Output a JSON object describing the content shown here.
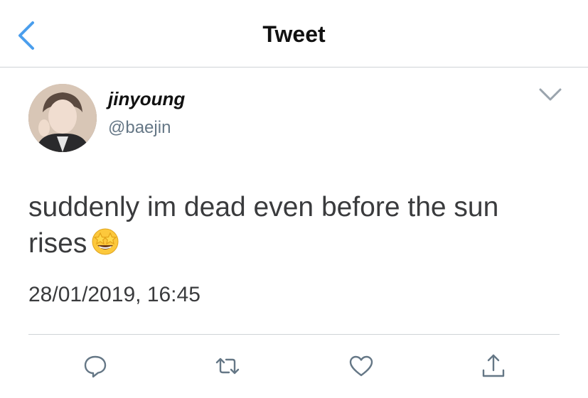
{
  "header": {
    "title": "Tweet",
    "back_icon": "chevron-left-icon"
  },
  "tweet": {
    "author": {
      "display_name": "jinyoung",
      "handle": "@baejin"
    },
    "text": "suddenly im dead even before the sun rises",
    "emoji": "star-struck-emoji",
    "timestamp": "28/01/2019, 16:45"
  },
  "actions": [
    {
      "icon": "reply-icon"
    },
    {
      "icon": "retweet-icon"
    },
    {
      "icon": "like-icon"
    },
    {
      "icon": "share-icon"
    }
  ],
  "colors": {
    "accent": "#4a9eed",
    "muted": "#657786",
    "icon": "#657786"
  }
}
